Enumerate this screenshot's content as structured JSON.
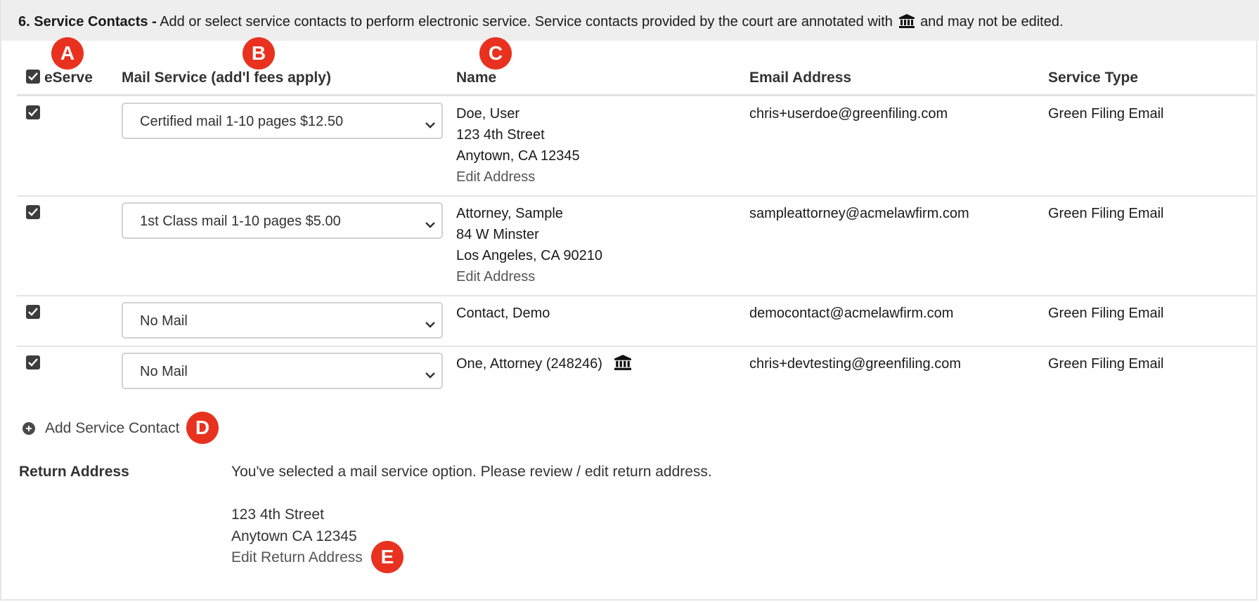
{
  "header": {
    "section_label": "6. Service Contacts -",
    "description_before_icon": "Add or select service contacts to perform electronic service. Service contacts provided by the court are annotated with",
    "description_after_icon": "and may not be edited.",
    "court_icon": "bank-icon"
  },
  "columns": {
    "eserve": "eServe",
    "mail_service": "Mail Service (add'l fees apply)",
    "name": "Name",
    "email": "Email Address",
    "service_type": "Service Type"
  },
  "rows": [
    {
      "eserve_checked": true,
      "mail_option": "Certified mail 1-10 pages $12.50",
      "name": "Doe, User",
      "address_line1": "123 4th Street",
      "address_line2": "Anytown, CA 12345",
      "edit_link": "Edit Address",
      "email": "chris+userdoe@greenfiling.com",
      "service_type": "Green Filing Email"
    },
    {
      "eserve_checked": true,
      "mail_option": "1st Class mail 1-10 pages $5.00",
      "name": "Attorney, Sample",
      "address_line1": "84 W Minster",
      "address_line2": "Los Angeles, CA 90210",
      "edit_link": "Edit Address",
      "email": "sampleattorney@acmelawfirm.com",
      "service_type": "Green Filing Email"
    },
    {
      "eserve_checked": true,
      "mail_option": "No Mail",
      "name": "Contact, Demo",
      "email": "democontact@acmelawfirm.com",
      "service_type": "Green Filing Email"
    },
    {
      "eserve_checked": true,
      "mail_option": "No Mail",
      "name": "One, Attorney (248246)",
      "court_provided": true,
      "email": "chris+devtesting@greenfiling.com",
      "service_type": "Green Filing Email"
    }
  ],
  "add_contact_label": "Add Service Contact",
  "return_address": {
    "label": "Return Address",
    "notice": "You've selected a mail service option. Please review / edit return address.",
    "line1": "123 4th Street",
    "line2": "Anytown CA 12345",
    "edit_link": "Edit Return Address"
  },
  "callouts": {
    "a": "A",
    "b": "B",
    "c": "C",
    "d": "D",
    "e": "E"
  },
  "colors": {
    "callout": "#e8321f",
    "header_bg": "#eeeeee",
    "checkbox": "#3d3d3d"
  }
}
